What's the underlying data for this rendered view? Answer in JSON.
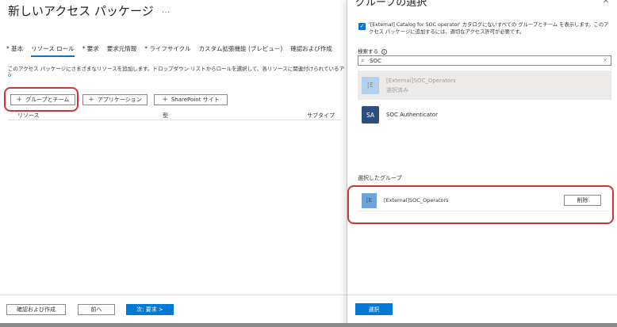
{
  "page": {
    "title": "新しいアクセス パッケージ",
    "ellipsis": "···",
    "tabs": [
      "* 基本",
      "リソース ロール",
      "* 要求",
      "要求元情報",
      "* ライフサイクル",
      "カスタム拡張機能 (プレビュー)",
      "確認および作成"
    ],
    "description": "このアクセス パッケージにさまざまなリソースを追加します。ドロップダウン リストからロールを選択して、各リソースに関連付けられているアクセス許",
    "description_link": "ö",
    "buttons": {
      "groups_teams": "グループとチーム",
      "applications": "アプリケーション",
      "sharepoint": "SharePoint サイト",
      "plus": "+"
    },
    "columns": [
      "リソース",
      "型",
      "サブタイプ"
    ],
    "footer": {
      "review_create": "確認および作成",
      "previous": "前へ",
      "next": "次: 要求 >"
    }
  },
  "panel": {
    "title": "グループの選択",
    "close_icon": "close-icon",
    "checkbox_checked": true,
    "checkbox_text": "'[External] Catalog for SOC operator' カタログにないすべての グループとチーム を表示します。このアクセス パッケージに追加するには、適切なアクセス許可が必要です。",
    "search": {
      "label": "検索する",
      "info_icon": "i",
      "value": "SOC",
      "search_icon": "⌕",
      "clear_icon": "×"
    },
    "results": [
      {
        "initials": "[E",
        "name": "[External]SOC_Operators",
        "status": "選択済み"
      },
      {
        "initials": "SA",
        "name": "SOC Authenticator",
        "status": ""
      }
    ],
    "selected_header": "選択したグループ",
    "selected": [
      {
        "initials": "[E",
        "name": "[External]SOC_Operators",
        "remove_label": "削除"
      }
    ],
    "select_button": "選択"
  },
  "colors": {
    "accent": "#0078d4",
    "highlight": "#d13438"
  }
}
